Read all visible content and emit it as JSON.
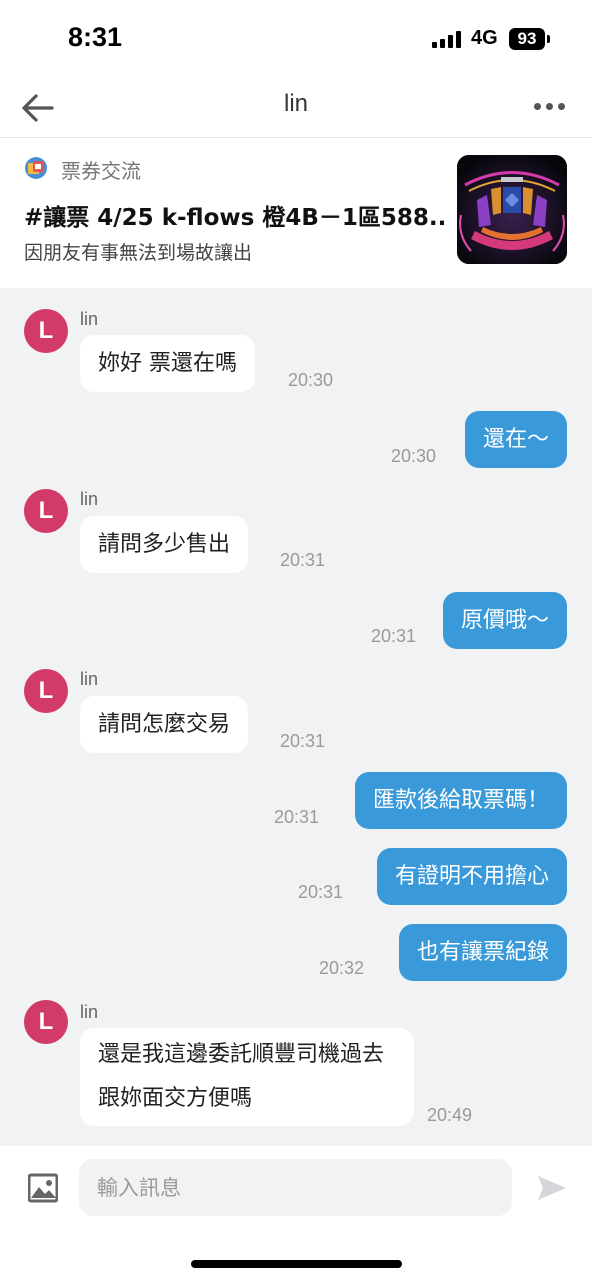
{
  "status_bar": {
    "time": "8:31",
    "network": "4G",
    "battery": "93"
  },
  "nav": {
    "title": "lin"
  },
  "post": {
    "board": "票券交流",
    "title": "#讓票 4/25 k-flows 橙4B－1區588...",
    "description": "因朋友有事無法到場故讓出"
  },
  "messages": [
    {
      "from": "lin",
      "sender": "lin",
      "avatar": "L",
      "text": "妳好 票還在嗎",
      "time": "20:30"
    },
    {
      "from": "me",
      "text": "還在～",
      "time": "20:30"
    },
    {
      "from": "lin",
      "sender": "lin",
      "avatar": "L",
      "text": "請問多少售出",
      "time": "20:31"
    },
    {
      "from": "me",
      "text": "原價哦～",
      "time": "20:31"
    },
    {
      "from": "lin",
      "sender": "lin",
      "avatar": "L",
      "text": "請問怎麼交易",
      "time": "20:31"
    },
    {
      "from": "me",
      "text": "匯款後給取票碼！",
      "time": "20:31"
    },
    {
      "from": "me",
      "text": "有證明不用擔心",
      "time": "20:31"
    },
    {
      "from": "me",
      "text": "也有讓票紀錄",
      "time": "20:32"
    },
    {
      "from": "lin",
      "sender": "lin",
      "avatar": "L",
      "text": "還是我這邊委託順豐司機過去跟妳面交方便嗎",
      "time": "20:49"
    }
  ],
  "composer": {
    "placeholder": "輸入訊息"
  },
  "colors": {
    "outgoing_bubble": "#3a9ad9",
    "incoming_bubble": "#ffffff",
    "chat_background": "#f1f2f4",
    "avatar": "#d23a67"
  },
  "icons": {
    "back": "arrow-left-icon",
    "more": "more-dots-icon",
    "board": "board-icon",
    "image": "image-icon",
    "send": "send-icon"
  }
}
